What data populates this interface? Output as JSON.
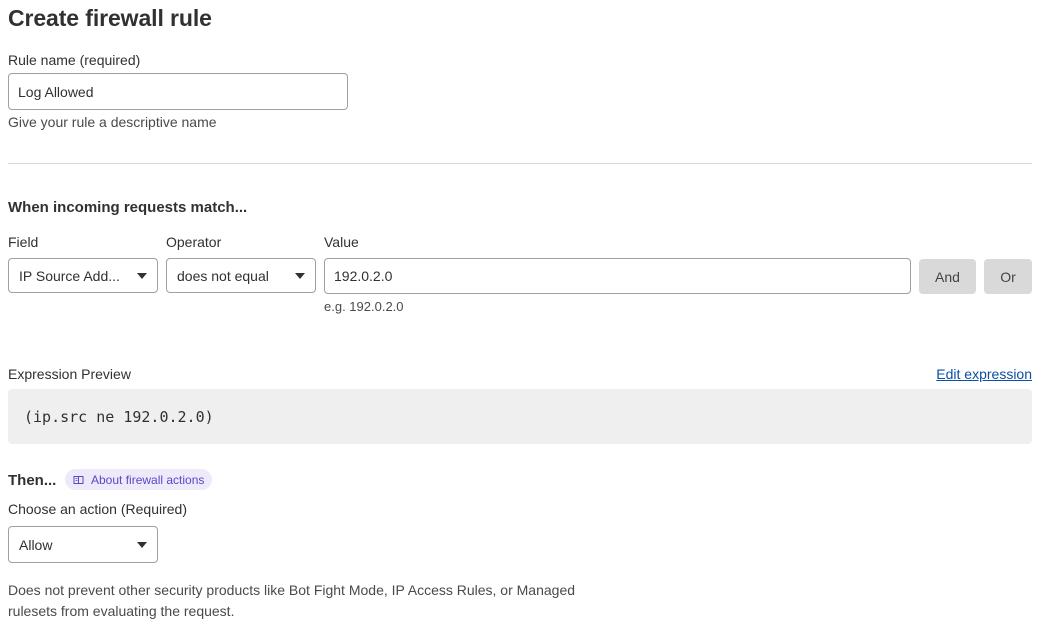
{
  "page": {
    "title": "Create firewall rule"
  },
  "rule_name": {
    "label": "Rule name (required)",
    "value": "Log Allowed",
    "help": "Give your rule a descriptive name"
  },
  "match": {
    "heading": "When incoming requests match...",
    "field_label": "Field",
    "field_value": "IP Source Add...",
    "operator_label": "Operator",
    "operator_value": "does not equal",
    "value_label": "Value",
    "value": "192.0.2.0",
    "value_help": "e.g. 192.0.2.0",
    "and_button": "And",
    "or_button": "Or"
  },
  "expression": {
    "label": "Expression Preview",
    "edit_link": "Edit expression",
    "text": "(ip.src ne 192.0.2.0)"
  },
  "then": {
    "heading": "Then...",
    "about_link": "About firewall actions",
    "action_label": "Choose an action (Required)",
    "action_value": "Allow",
    "description": "Does not prevent other security products like Bot Fight Mode, IP Access Rules, or Managed rulesets from evaluating the request."
  },
  "colors": {
    "link": "#0c4fa3",
    "pill_text": "#5b47c9",
    "pill_bg": "#eeeaf9",
    "button_bg": "#d9d9d9",
    "expression_bg": "#efefef"
  },
  "icons": {
    "about_link_icon": "book-icon",
    "select_caret": "caret-down-icon"
  }
}
